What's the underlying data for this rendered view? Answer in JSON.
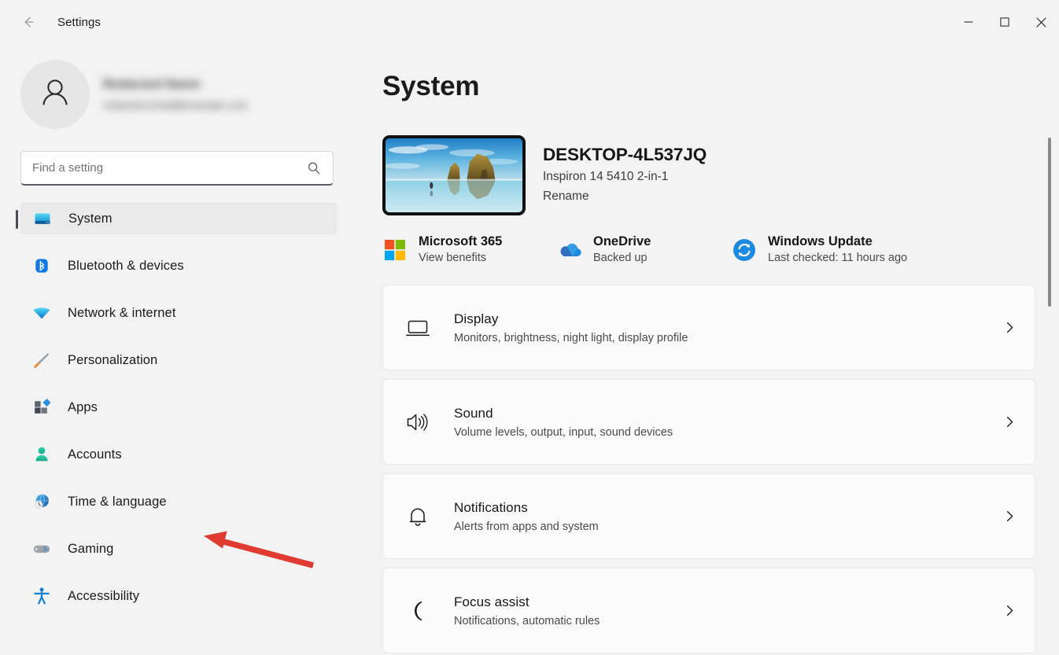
{
  "window": {
    "title": "Settings",
    "back_icon": "back-arrow-icon",
    "controls": {
      "minimize": "minimize-icon",
      "maximize": "maximize-icon",
      "close": "close-icon"
    }
  },
  "sidebar": {
    "account": {
      "name": "",
      "email": "",
      "avatar_icon": "person-avatar-icon",
      "redacted": true
    },
    "search": {
      "placeholder": "Find a setting",
      "value": "",
      "icon": "search-icon"
    },
    "items": [
      {
        "label": "System",
        "icon": "monitor-icon",
        "selected": true
      },
      {
        "label": "Bluetooth & devices",
        "icon": "bluetooth-icon",
        "selected": false
      },
      {
        "label": "Network & internet",
        "icon": "wifi-icon",
        "selected": false
      },
      {
        "label": "Personalization",
        "icon": "paintbrush-icon",
        "selected": false
      },
      {
        "label": "Apps",
        "icon": "apps-grid-icon",
        "selected": false
      },
      {
        "label": "Accounts",
        "icon": "person-icon",
        "selected": false
      },
      {
        "label": "Time & language",
        "icon": "globe-clock-icon",
        "selected": false
      },
      {
        "label": "Gaming",
        "icon": "gamepad-icon",
        "selected": false
      },
      {
        "label": "Accessibility",
        "icon": "accessibility-icon",
        "selected": false
      }
    ]
  },
  "main": {
    "page_title": "System",
    "device": {
      "name": "DESKTOP-4L537JQ",
      "model": "Inspiron 14 5410 2-in-1",
      "rename_label": "Rename",
      "thumbnail_icon": "beach-wallpaper-thumbnail"
    },
    "quicklinks": [
      {
        "title": "Microsoft 365",
        "subtitle": "View benefits",
        "icon": "microsoft-logo-icon"
      },
      {
        "title": "OneDrive",
        "subtitle": "Backed up",
        "icon": "onedrive-cloud-icon"
      },
      {
        "title": "Windows Update",
        "subtitle": "Last checked: 11 hours ago",
        "icon": "windows-update-sync-icon"
      }
    ],
    "cards": [
      {
        "title": "Display",
        "subtitle": "Monitors, brightness, night light, display profile",
        "icon": "monitor-outline-icon",
        "chevron": "chevron-right-icon"
      },
      {
        "title": "Sound",
        "subtitle": "Volume levels, output, input, sound devices",
        "icon": "speaker-icon",
        "chevron": "chevron-right-icon"
      },
      {
        "title": "Notifications",
        "subtitle": "Alerts from apps and system",
        "icon": "bell-icon",
        "chevron": "chevron-right-icon"
      },
      {
        "title": "Focus assist",
        "subtitle": "Notifications, automatic rules",
        "icon": "moon-icon",
        "chevron": "chevron-right-icon"
      }
    ]
  },
  "annotation": {
    "type": "red-arrow",
    "points_to": "Time & language",
    "color": "#e03b30"
  },
  "colors": {
    "page_background": "#f3f3f3",
    "card_background": "#fbfbfb",
    "selected_nav": "#eaeaea",
    "accent_indicator": "#4a4a5a",
    "annotation_red": "#e03b30",
    "text_primary": "#1b1b1b",
    "text_secondary": "#4b4b4b"
  },
  "scrollbar": {
    "visible": true
  }
}
